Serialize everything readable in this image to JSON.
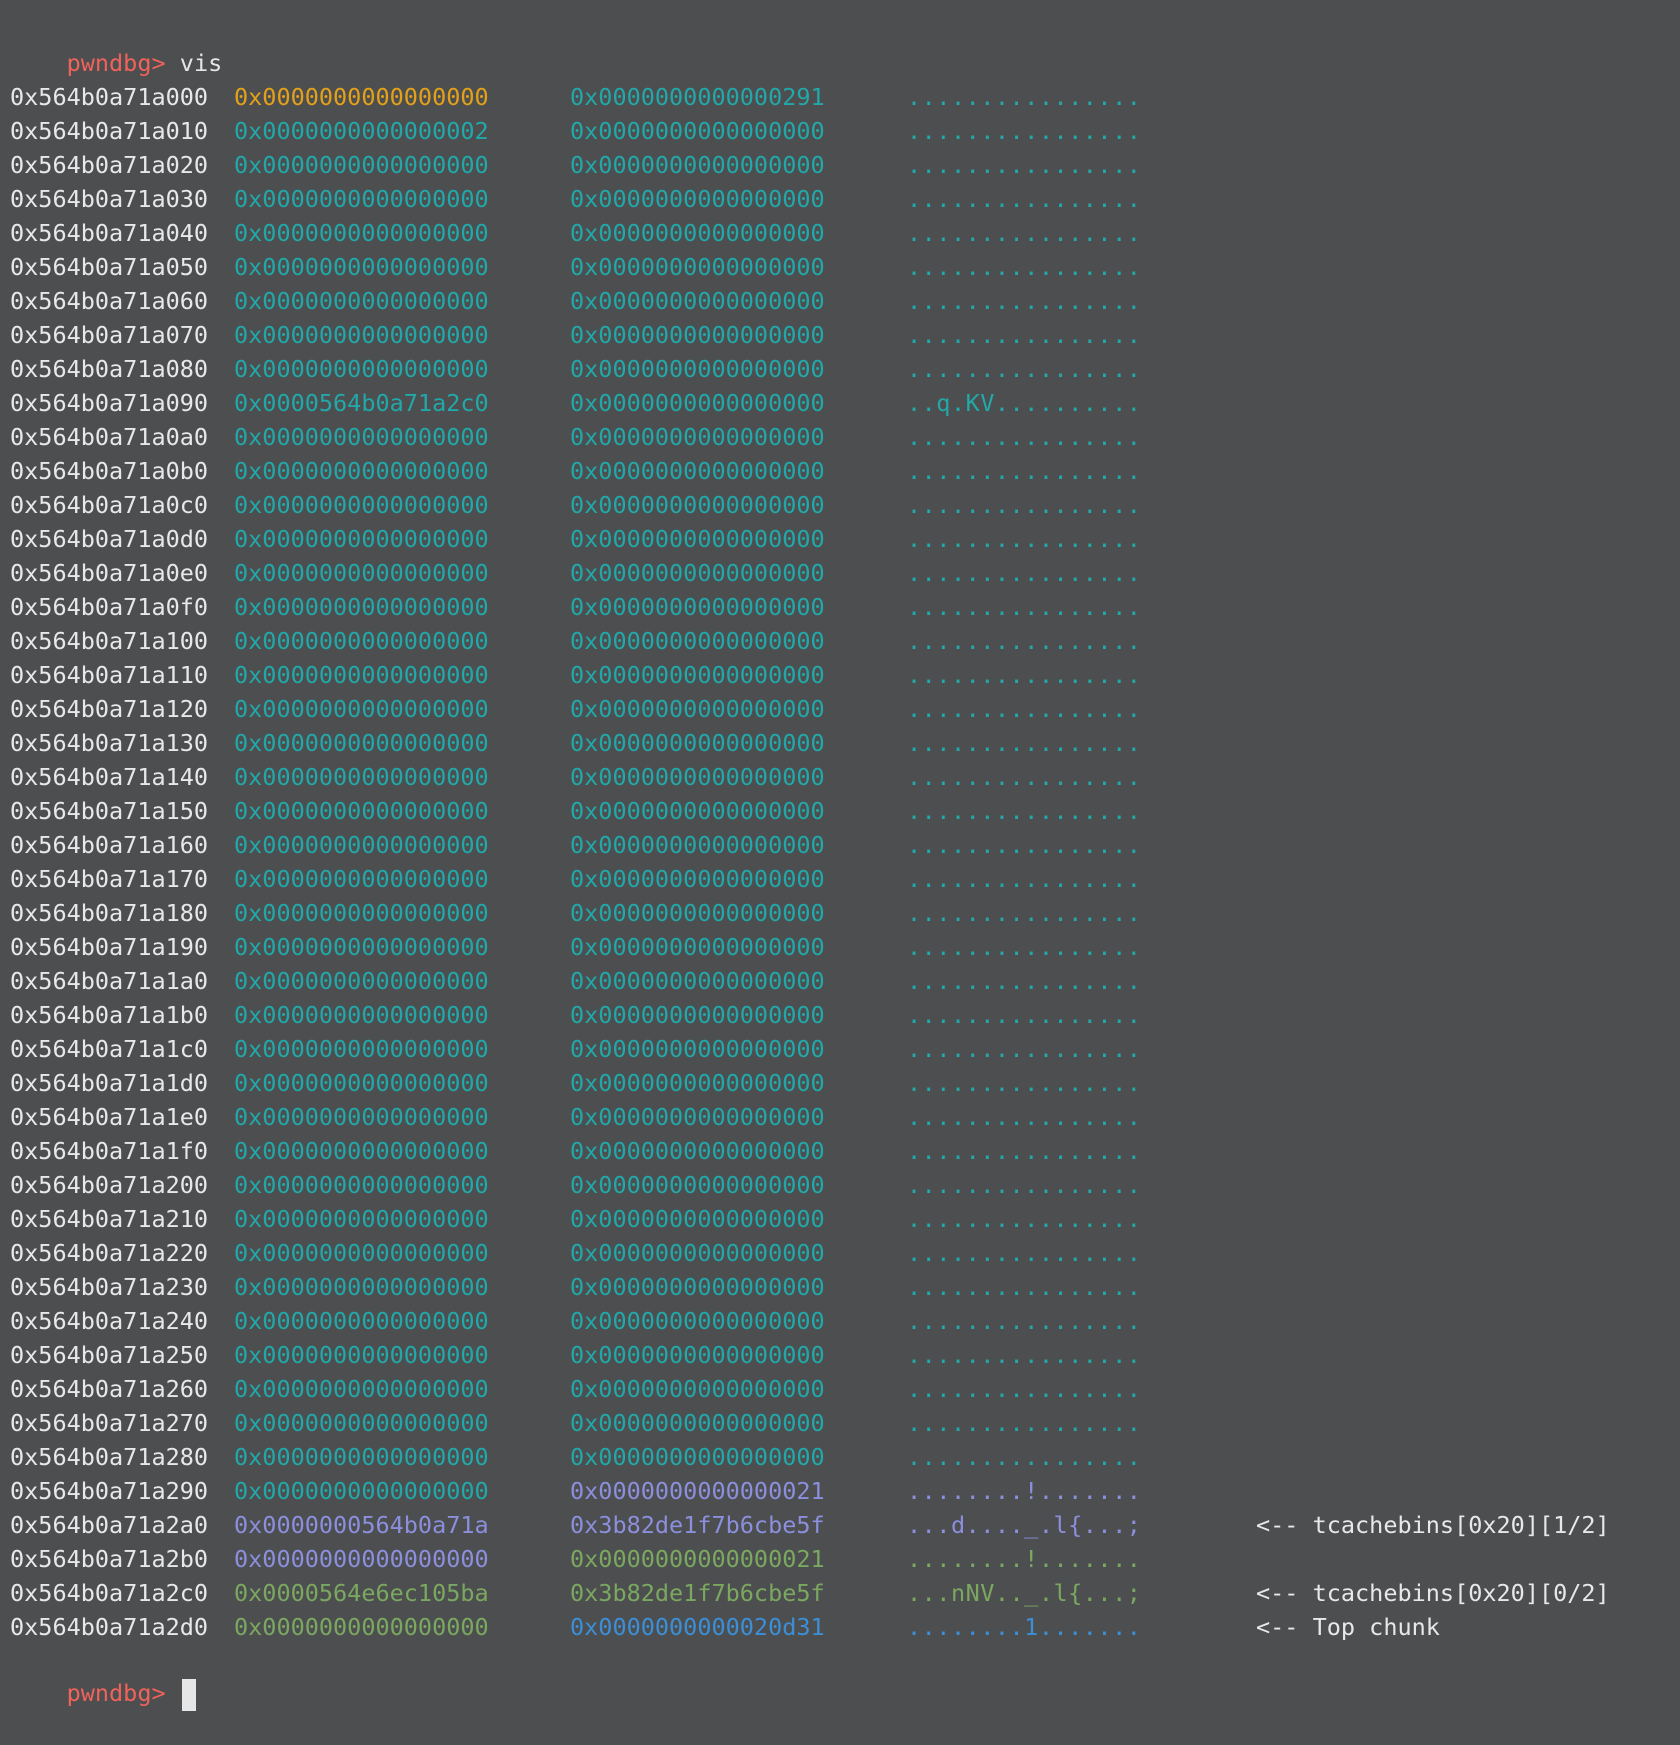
{
  "prompt": "pwndbg>",
  "command": "vis",
  "colors": {
    "background": "#4d4e50",
    "prompt": "#f0625a",
    "address": "#e8e8e8",
    "yellow": "#e3a11a",
    "teal": "#22a8a8",
    "purple": "#8b8fdc",
    "green": "#7aa860",
    "blue": "#3c8fd6"
  },
  "rows": [
    {
      "addr": "0x564b0a71a000",
      "q1": "0x0000000000000000",
      "c1": "yellow",
      "q2": "0x0000000000000291",
      "c2": "teal",
      "ascii": "................",
      "ca": "teal",
      "note": ""
    },
    {
      "addr": "0x564b0a71a010",
      "q1": "0x0000000000000002",
      "c1": "teal",
      "q2": "0x0000000000000000",
      "c2": "teal",
      "ascii": "................",
      "ca": "teal",
      "note": ""
    },
    {
      "addr": "0x564b0a71a020",
      "q1": "0x0000000000000000",
      "c1": "teal",
      "q2": "0x0000000000000000",
      "c2": "teal",
      "ascii": "................",
      "ca": "teal",
      "note": ""
    },
    {
      "addr": "0x564b0a71a030",
      "q1": "0x0000000000000000",
      "c1": "teal",
      "q2": "0x0000000000000000",
      "c2": "teal",
      "ascii": "................",
      "ca": "teal",
      "note": ""
    },
    {
      "addr": "0x564b0a71a040",
      "q1": "0x0000000000000000",
      "c1": "teal",
      "q2": "0x0000000000000000",
      "c2": "teal",
      "ascii": "................",
      "ca": "teal",
      "note": ""
    },
    {
      "addr": "0x564b0a71a050",
      "q1": "0x0000000000000000",
      "c1": "teal",
      "q2": "0x0000000000000000",
      "c2": "teal",
      "ascii": "................",
      "ca": "teal",
      "note": ""
    },
    {
      "addr": "0x564b0a71a060",
      "q1": "0x0000000000000000",
      "c1": "teal",
      "q2": "0x0000000000000000",
      "c2": "teal",
      "ascii": "................",
      "ca": "teal",
      "note": ""
    },
    {
      "addr": "0x564b0a71a070",
      "q1": "0x0000000000000000",
      "c1": "teal",
      "q2": "0x0000000000000000",
      "c2": "teal",
      "ascii": "................",
      "ca": "teal",
      "note": ""
    },
    {
      "addr": "0x564b0a71a080",
      "q1": "0x0000000000000000",
      "c1": "teal",
      "q2": "0x0000000000000000",
      "c2": "teal",
      "ascii": "................",
      "ca": "teal",
      "note": ""
    },
    {
      "addr": "0x564b0a71a090",
      "q1": "0x0000564b0a71a2c0",
      "c1": "teal",
      "q2": "0x0000000000000000",
      "c2": "teal",
      "ascii": "..q.KV..........",
      "ca": "teal",
      "note": ""
    },
    {
      "addr": "0x564b0a71a0a0",
      "q1": "0x0000000000000000",
      "c1": "teal",
      "q2": "0x0000000000000000",
      "c2": "teal",
      "ascii": "................",
      "ca": "teal",
      "note": ""
    },
    {
      "addr": "0x564b0a71a0b0",
      "q1": "0x0000000000000000",
      "c1": "teal",
      "q2": "0x0000000000000000",
      "c2": "teal",
      "ascii": "................",
      "ca": "teal",
      "note": ""
    },
    {
      "addr": "0x564b0a71a0c0",
      "q1": "0x0000000000000000",
      "c1": "teal",
      "q2": "0x0000000000000000",
      "c2": "teal",
      "ascii": "................",
      "ca": "teal",
      "note": ""
    },
    {
      "addr": "0x564b0a71a0d0",
      "q1": "0x0000000000000000",
      "c1": "teal",
      "q2": "0x0000000000000000",
      "c2": "teal",
      "ascii": "................",
      "ca": "teal",
      "note": ""
    },
    {
      "addr": "0x564b0a71a0e0",
      "q1": "0x0000000000000000",
      "c1": "teal",
      "q2": "0x0000000000000000",
      "c2": "teal",
      "ascii": "................",
      "ca": "teal",
      "note": ""
    },
    {
      "addr": "0x564b0a71a0f0",
      "q1": "0x0000000000000000",
      "c1": "teal",
      "q2": "0x0000000000000000",
      "c2": "teal",
      "ascii": "................",
      "ca": "teal",
      "note": ""
    },
    {
      "addr": "0x564b0a71a100",
      "q1": "0x0000000000000000",
      "c1": "teal",
      "q2": "0x0000000000000000",
      "c2": "teal",
      "ascii": "................",
      "ca": "teal",
      "note": ""
    },
    {
      "addr": "0x564b0a71a110",
      "q1": "0x0000000000000000",
      "c1": "teal",
      "q2": "0x0000000000000000",
      "c2": "teal",
      "ascii": "................",
      "ca": "teal",
      "note": ""
    },
    {
      "addr": "0x564b0a71a120",
      "q1": "0x0000000000000000",
      "c1": "teal",
      "q2": "0x0000000000000000",
      "c2": "teal",
      "ascii": "................",
      "ca": "teal",
      "note": ""
    },
    {
      "addr": "0x564b0a71a130",
      "q1": "0x0000000000000000",
      "c1": "teal",
      "q2": "0x0000000000000000",
      "c2": "teal",
      "ascii": "................",
      "ca": "teal",
      "note": ""
    },
    {
      "addr": "0x564b0a71a140",
      "q1": "0x0000000000000000",
      "c1": "teal",
      "q2": "0x0000000000000000",
      "c2": "teal",
      "ascii": "................",
      "ca": "teal",
      "note": ""
    },
    {
      "addr": "0x564b0a71a150",
      "q1": "0x0000000000000000",
      "c1": "teal",
      "q2": "0x0000000000000000",
      "c2": "teal",
      "ascii": "................",
      "ca": "teal",
      "note": ""
    },
    {
      "addr": "0x564b0a71a160",
      "q1": "0x0000000000000000",
      "c1": "teal",
      "q2": "0x0000000000000000",
      "c2": "teal",
      "ascii": "................",
      "ca": "teal",
      "note": ""
    },
    {
      "addr": "0x564b0a71a170",
      "q1": "0x0000000000000000",
      "c1": "teal",
      "q2": "0x0000000000000000",
      "c2": "teal",
      "ascii": "................",
      "ca": "teal",
      "note": ""
    },
    {
      "addr": "0x564b0a71a180",
      "q1": "0x0000000000000000",
      "c1": "teal",
      "q2": "0x0000000000000000",
      "c2": "teal",
      "ascii": "................",
      "ca": "teal",
      "note": ""
    },
    {
      "addr": "0x564b0a71a190",
      "q1": "0x0000000000000000",
      "c1": "teal",
      "q2": "0x0000000000000000",
      "c2": "teal",
      "ascii": "................",
      "ca": "teal",
      "note": ""
    },
    {
      "addr": "0x564b0a71a1a0",
      "q1": "0x0000000000000000",
      "c1": "teal",
      "q2": "0x0000000000000000",
      "c2": "teal",
      "ascii": "................",
      "ca": "teal",
      "note": ""
    },
    {
      "addr": "0x564b0a71a1b0",
      "q1": "0x0000000000000000",
      "c1": "teal",
      "q2": "0x0000000000000000",
      "c2": "teal",
      "ascii": "................",
      "ca": "teal",
      "note": ""
    },
    {
      "addr": "0x564b0a71a1c0",
      "q1": "0x0000000000000000",
      "c1": "teal",
      "q2": "0x0000000000000000",
      "c2": "teal",
      "ascii": "................",
      "ca": "teal",
      "note": ""
    },
    {
      "addr": "0x564b0a71a1d0",
      "q1": "0x0000000000000000",
      "c1": "teal",
      "q2": "0x0000000000000000",
      "c2": "teal",
      "ascii": "................",
      "ca": "teal",
      "note": ""
    },
    {
      "addr": "0x564b0a71a1e0",
      "q1": "0x0000000000000000",
      "c1": "teal",
      "q2": "0x0000000000000000",
      "c2": "teal",
      "ascii": "................",
      "ca": "teal",
      "note": ""
    },
    {
      "addr": "0x564b0a71a1f0",
      "q1": "0x0000000000000000",
      "c1": "teal",
      "q2": "0x0000000000000000",
      "c2": "teal",
      "ascii": "................",
      "ca": "teal",
      "note": ""
    },
    {
      "addr": "0x564b0a71a200",
      "q1": "0x0000000000000000",
      "c1": "teal",
      "q2": "0x0000000000000000",
      "c2": "teal",
      "ascii": "................",
      "ca": "teal",
      "note": ""
    },
    {
      "addr": "0x564b0a71a210",
      "q1": "0x0000000000000000",
      "c1": "teal",
      "q2": "0x0000000000000000",
      "c2": "teal",
      "ascii": "................",
      "ca": "teal",
      "note": ""
    },
    {
      "addr": "0x564b0a71a220",
      "q1": "0x0000000000000000",
      "c1": "teal",
      "q2": "0x0000000000000000",
      "c2": "teal",
      "ascii": "................",
      "ca": "teal",
      "note": ""
    },
    {
      "addr": "0x564b0a71a230",
      "q1": "0x0000000000000000",
      "c1": "teal",
      "q2": "0x0000000000000000",
      "c2": "teal",
      "ascii": "................",
      "ca": "teal",
      "note": ""
    },
    {
      "addr": "0x564b0a71a240",
      "q1": "0x0000000000000000",
      "c1": "teal",
      "q2": "0x0000000000000000",
      "c2": "teal",
      "ascii": "................",
      "ca": "teal",
      "note": ""
    },
    {
      "addr": "0x564b0a71a250",
      "q1": "0x0000000000000000",
      "c1": "teal",
      "q2": "0x0000000000000000",
      "c2": "teal",
      "ascii": "................",
      "ca": "teal",
      "note": ""
    },
    {
      "addr": "0x564b0a71a260",
      "q1": "0x0000000000000000",
      "c1": "teal",
      "q2": "0x0000000000000000",
      "c2": "teal",
      "ascii": "................",
      "ca": "teal",
      "note": ""
    },
    {
      "addr": "0x564b0a71a270",
      "q1": "0x0000000000000000",
      "c1": "teal",
      "q2": "0x0000000000000000",
      "c2": "teal",
      "ascii": "................",
      "ca": "teal",
      "note": ""
    },
    {
      "addr": "0x564b0a71a280",
      "q1": "0x0000000000000000",
      "c1": "teal",
      "q2": "0x0000000000000000",
      "c2": "teal",
      "ascii": "................",
      "ca": "teal",
      "note": ""
    },
    {
      "addr": "0x564b0a71a290",
      "q1": "0x0000000000000000",
      "c1": "teal",
      "q2": "0x0000000000000021",
      "c2": "purple",
      "ascii": "........!.......",
      "ca": "purple",
      "note": ""
    },
    {
      "addr": "0x564b0a71a2a0",
      "q1": "0x0000000564b0a71a",
      "c1": "purple",
      "q2": "0x3b82de1f7b6cbe5f",
      "c2": "purple",
      "ascii": "...d...._.l{...;",
      "ca": "purple",
      "note": "<-- tcachebins[0x20][1/2]"
    },
    {
      "addr": "0x564b0a71a2b0",
      "q1": "0x0000000000000000",
      "c1": "purple",
      "q2": "0x0000000000000021",
      "c2": "green",
      "ascii": "........!.......",
      "ca": "green",
      "note": ""
    },
    {
      "addr": "0x564b0a71a2c0",
      "q1": "0x0000564e6ec105ba",
      "c1": "green",
      "q2": "0x3b82de1f7b6cbe5f",
      "c2": "green",
      "ascii": "...nNV.._.l{...;",
      "ca": "green",
      "note": "<-- tcachebins[0x20][0/2]"
    },
    {
      "addr": "0x564b0a71a2d0",
      "q1": "0x0000000000000000",
      "c1": "green",
      "q2": "0x0000000000020d31",
      "c2": "blue",
      "ascii": "........1.......",
      "ca": "blue",
      "note": "<-- Top chunk"
    }
  ]
}
